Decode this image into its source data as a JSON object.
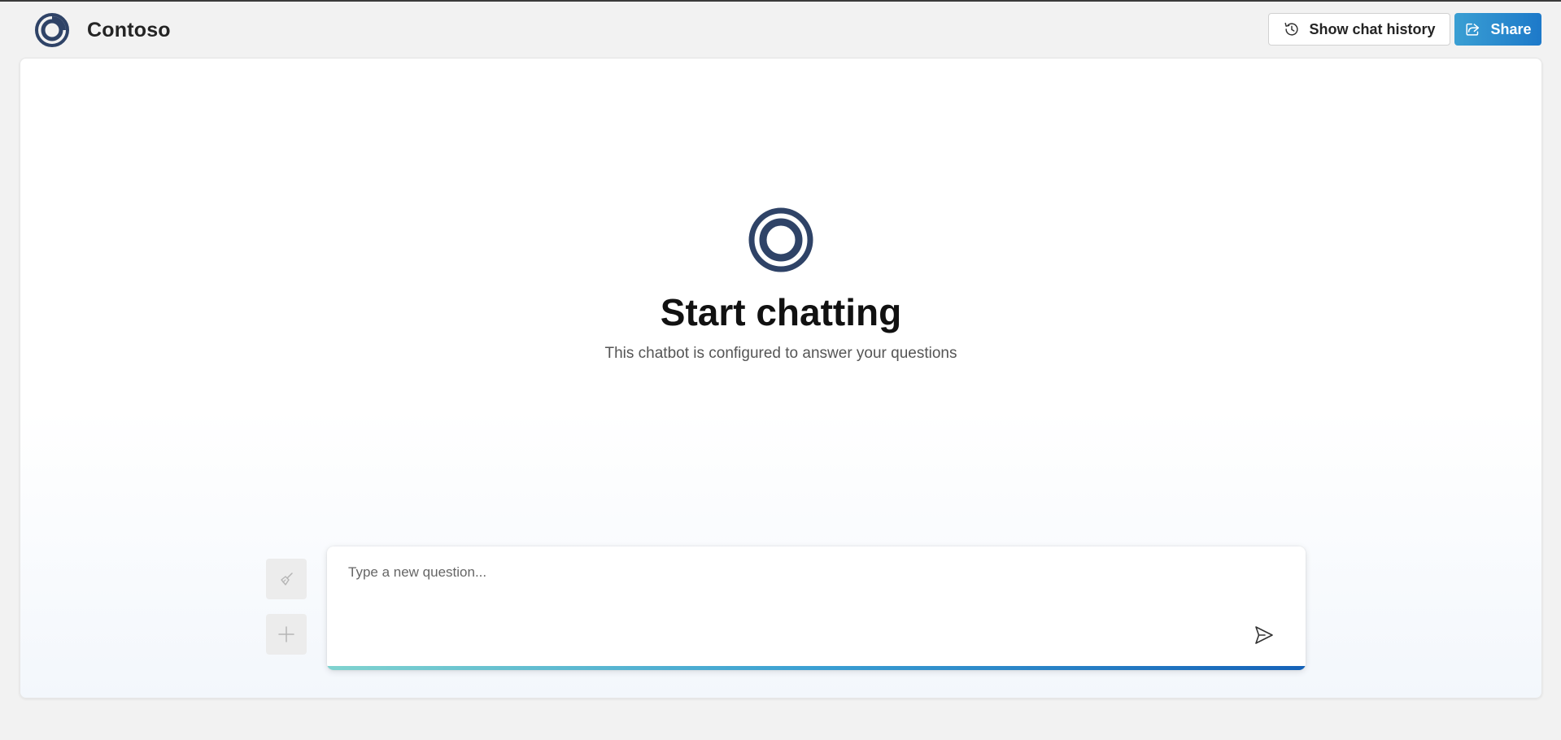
{
  "header": {
    "brand_name": "Contoso",
    "history_button_label": "Show chat history",
    "share_button_label": "Share"
  },
  "empty_state": {
    "title": "Start chatting",
    "subtitle": "This chatbot is configured to answer your questions"
  },
  "composer": {
    "placeholder": "Type a new question..."
  },
  "colors": {
    "logo": "#2f4367",
    "share_start": "#3a9fd3",
    "share_end": "#1d79c9",
    "accent_bar_start": "#7fd3cf",
    "accent_bar_end": "#1562b8"
  },
  "icons": {
    "brand": "contoso-logo-icon",
    "history": "history-clock-icon",
    "share": "share-icon",
    "clear": "broom-icon",
    "new_chat": "plus-icon",
    "send": "send-icon"
  }
}
